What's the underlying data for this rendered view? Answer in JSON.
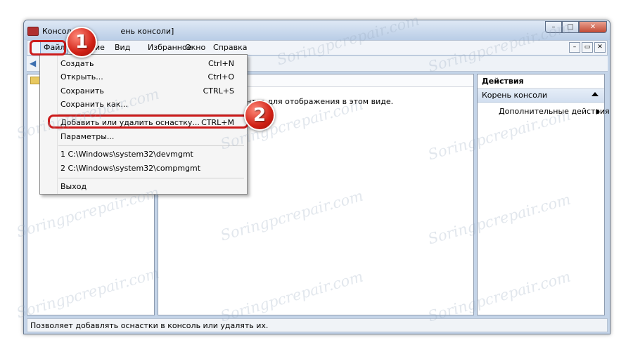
{
  "window": {
    "title": "Консоль1 - [Корень консоли]",
    "title_visible": "Консол",
    "title_tail": "ень консоли]"
  },
  "window_buttons": {
    "minimize": "–",
    "maximize": "□",
    "close": "✕"
  },
  "menubar": {
    "items": [
      {
        "label": "Файл",
        "active": true
      },
      {
        "label": "Действие"
      },
      {
        "label": "Вид"
      },
      {
        "label": "Избранное"
      },
      {
        "label": "Окно"
      },
      {
        "label": "Справка"
      }
    ],
    "visible_fragment_action": "ие"
  },
  "child_buttons": {
    "minimize": "–",
    "restore": "▭",
    "close": "✕"
  },
  "file_menu": {
    "items": [
      {
        "label": "Создать",
        "shortcut": "Ctrl+N"
      },
      {
        "label": "Открыть...",
        "shortcut": "Ctrl+O"
      },
      {
        "label": "Сохранить",
        "shortcut": "CTRL+S"
      },
      {
        "label": "Сохранить как...",
        "shortcut": ""
      },
      {
        "label": "Добавить или удалить оснастку...",
        "shortcut": "CTRL+M"
      },
      {
        "label": "Параметры...",
        "shortcut": ""
      },
      {
        "label": "1 C:\\Windows\\system32\\devmgmt",
        "shortcut": ""
      },
      {
        "label": "2 C:\\Windows\\system32\\compmgmt",
        "shortcut": ""
      },
      {
        "label": "Выход",
        "shortcut": ""
      }
    ]
  },
  "center": {
    "message_fragment": "ментов для отображения в этом виде."
  },
  "actions": {
    "title": "Действия",
    "section": "Корень консоли",
    "more": "Дополнительные действия"
  },
  "statusbar": {
    "text": "Позволяет добавлять оснастки в консоль или удалять их."
  },
  "badges": {
    "one": "1",
    "two": "2"
  },
  "watermark": {
    "text": "Soringpcrepair.com"
  },
  "colors": {
    "accent_red": "#cc1b1b",
    "titlebar": "#c4d4e8"
  }
}
